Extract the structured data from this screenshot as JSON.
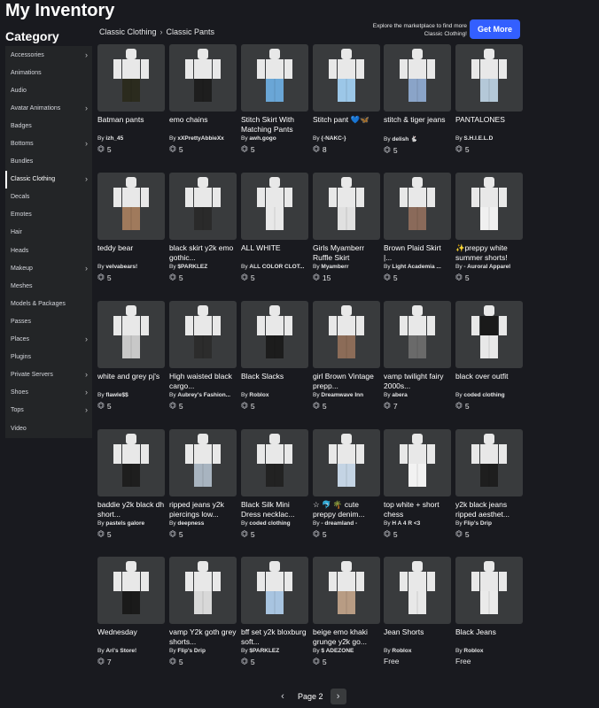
{
  "page_title": "My Inventory",
  "category_title": "Category",
  "sidebar": {
    "items": [
      {
        "label": "Accessories",
        "chevron": true,
        "active": false
      },
      {
        "label": "Animations",
        "chevron": false,
        "active": false
      },
      {
        "label": "Audio",
        "chevron": false,
        "active": false
      },
      {
        "label": "Avatar Animations",
        "chevron": true,
        "active": false
      },
      {
        "label": "Badges",
        "chevron": false,
        "active": false
      },
      {
        "label": "Bottoms",
        "chevron": true,
        "active": false
      },
      {
        "label": "Bundles",
        "chevron": false,
        "active": false
      },
      {
        "label": "Classic Clothing",
        "chevron": true,
        "active": true
      },
      {
        "label": "Decals",
        "chevron": false,
        "active": false
      },
      {
        "label": "Emotes",
        "chevron": false,
        "active": false
      },
      {
        "label": "Hair",
        "chevron": false,
        "active": false
      },
      {
        "label": "Heads",
        "chevron": false,
        "active": false
      },
      {
        "label": "Makeup",
        "chevron": true,
        "active": false
      },
      {
        "label": "Meshes",
        "chevron": false,
        "active": false
      },
      {
        "label": "Models & Packages",
        "chevron": false,
        "active": false
      },
      {
        "label": "Passes",
        "chevron": false,
        "active": false
      },
      {
        "label": "Places",
        "chevron": true,
        "active": false
      },
      {
        "label": "Plugins",
        "chevron": false,
        "active": false
      },
      {
        "label": "Private Servers",
        "chevron": true,
        "active": false
      },
      {
        "label": "Shoes",
        "chevron": true,
        "active": false
      },
      {
        "label": "Tops",
        "chevron": true,
        "active": false
      },
      {
        "label": "Video",
        "chevron": false,
        "active": false
      }
    ]
  },
  "breadcrumb": [
    "Classic Clothing",
    "Classic Pants"
  ],
  "promo": {
    "text": "Explore the marketplace to find more Classic Clothing!",
    "button": "Get More"
  },
  "icons": {
    "robux": "robux-icon",
    "chevron": "chevron-right-icon"
  },
  "colors": {
    "accent": "#335fff",
    "tile": "#393b3d",
    "background": "#191a1f"
  },
  "items": [
    {
      "name": "Batman pants",
      "by": "By",
      "creator": "izh_45",
      "price": "5",
      "pants": "#2b2b1e",
      "shirt": ""
    },
    {
      "name": "emo chains",
      "by": "By",
      "creator": "xXPrettyAbbieXx",
      "price": "5",
      "pants": "#1e1e1e",
      "shirt": ""
    },
    {
      "name": "Stitch Skirt With Matching Pants",
      "by": "By",
      "creator": "awh.gogo",
      "price": "5",
      "pants": "#6aa6d6",
      "shirt": ""
    },
    {
      "name": "Stitch pant 💙🦋",
      "by": "By",
      "creator": "{-NAKC-}",
      "price": "8",
      "pants": "#9cc7e8",
      "shirt": ""
    },
    {
      "name": "stitch & tiger jeans",
      "by": "By",
      "creator": "delish 🐇",
      "price": "5",
      "pants": "#8aa4c8",
      "shirt": ""
    },
    {
      "name": "PANTALONES",
      "by": "By",
      "creator": "S.H.I.E.L.D",
      "price": "5",
      "pants": "#b4c8d8",
      "shirt": ""
    },
    {
      "name": "teddy bear",
      "by": "By",
      "creator": "velvabears!",
      "price": "5",
      "pants": "#a07a5c",
      "shirt": ""
    },
    {
      "name": "black skirt y2k emo gothic...",
      "by": "By",
      "creator": "$PARKLEZ",
      "price": "5",
      "pants": "#2a2a2a",
      "shirt": ""
    },
    {
      "name": "ALL WHITE",
      "by": "By",
      "creator": "ALL COLOR CLOT...",
      "price": "5",
      "pants": "#e8e8e8",
      "shirt": ""
    },
    {
      "name": "Girls Myamberr Ruffle Skirt",
      "by": "By",
      "creator": "Myamberr",
      "price": "15",
      "pants": "#e0e0e0",
      "shirt": ""
    },
    {
      "name": "Brown Plaid Skirt |...",
      "by": "By",
      "creator": "Light Academia ...",
      "price": "5",
      "pants": "#8a6a5a",
      "shirt": ""
    },
    {
      "name": "✨preppy white summer shorts!",
      "by": "By",
      "creator": "- Auroral Apparel",
      "price": "5",
      "pants": "#f0f0f0",
      "shirt": ""
    },
    {
      "name": "white and grey pj's",
      "by": "By",
      "creator": "flawle$$",
      "price": "5",
      "pants": "#c8c8c8",
      "shirt": ""
    },
    {
      "name": "High waisted black cargo...",
      "by": "By",
      "creator": "Aubrey's Fashion...",
      "price": "5",
      "pants": "#2c2c2c",
      "shirt": ""
    },
    {
      "name": "Black Slacks",
      "by": "By",
      "creator": "Roblox",
      "price": "5",
      "pants": "#1c1c1c",
      "shirt": ""
    },
    {
      "name": "girl Brown Vintage prepp...",
      "by": "By",
      "creator": "Dreamwave Inn",
      "price": "5",
      "pants": "#8c6c58",
      "shirt": ""
    },
    {
      "name": "vamp twilight fairy 2000s...",
      "by": "By",
      "creator": "abera",
      "price": "7",
      "pants": "#6a6a6a",
      "shirt": ""
    },
    {
      "name": "black over outfit",
      "by": "By",
      "creator": "coded clothing",
      "price": "5",
      "pants": "#e8e8e8",
      "shirt": "#1a1a1a"
    },
    {
      "name": "baddie y2k black dh short...",
      "by": "By",
      "creator": "pastels galore",
      "price": "5",
      "pants": "#1e1e1e",
      "shirt": ""
    },
    {
      "name": "ripped jeans y2k piercings low...",
      "by": "By",
      "creator": "deepness",
      "price": "5",
      "pants": "#a8b4c0",
      "shirt": ""
    },
    {
      "name": "Black Silk Mini Dress necklac...",
      "by": "By",
      "creator": "coded clothing",
      "price": "5",
      "pants": "#222222",
      "shirt": ""
    },
    {
      "name": "☆ 🐬 🌴 cute preppy denim...",
      "by": "By",
      "creator": "- dreamland -",
      "price": "5",
      "pants": "#c4d4e4",
      "shirt": ""
    },
    {
      "name": "top white + short chess",
      "by": "By",
      "creator": "H A 4 R <3",
      "price": "5",
      "pants": "#f2f2f2",
      "shirt": ""
    },
    {
      "name": "y2k black jeans ripped aesthet...",
      "by": "By",
      "creator": "Flip's Drip",
      "price": "5",
      "pants": "#1e1e1e",
      "shirt": ""
    },
    {
      "name": "Wednesday",
      "by": "By",
      "creator": "Ari's Store!",
      "price": "7",
      "pants": "#1a1a1a",
      "shirt": ""
    },
    {
      "name": "vamp Y2k goth grey shorts...",
      "by": "By",
      "creator": "Flip's Drip",
      "price": "5",
      "pants": "#d8d8d8",
      "shirt": ""
    },
    {
      "name": "bff set y2k bloxburg soft...",
      "by": "By",
      "creator": "$PARKLEZ",
      "price": "5",
      "pants": "#a8c4e0",
      "shirt": ""
    },
    {
      "name": "beige emo khaki grunge y2k go...",
      "by": "By",
      "creator": "$ ADEZONE",
      "price": "5",
      "pants": "#b89c84",
      "shirt": ""
    },
    {
      "name": "Jean Shorts",
      "by": "By",
      "creator": "Roblox",
      "price": "Free",
      "pants": "#e8e8e8",
      "shirt": ""
    },
    {
      "name": "Black Jeans",
      "by": "By",
      "creator": "Roblox",
      "price": "Free",
      "pants": "#eaeaea",
      "shirt": ""
    }
  ],
  "pagination": {
    "label": "Page 2",
    "prev": "‹",
    "next": "›"
  }
}
